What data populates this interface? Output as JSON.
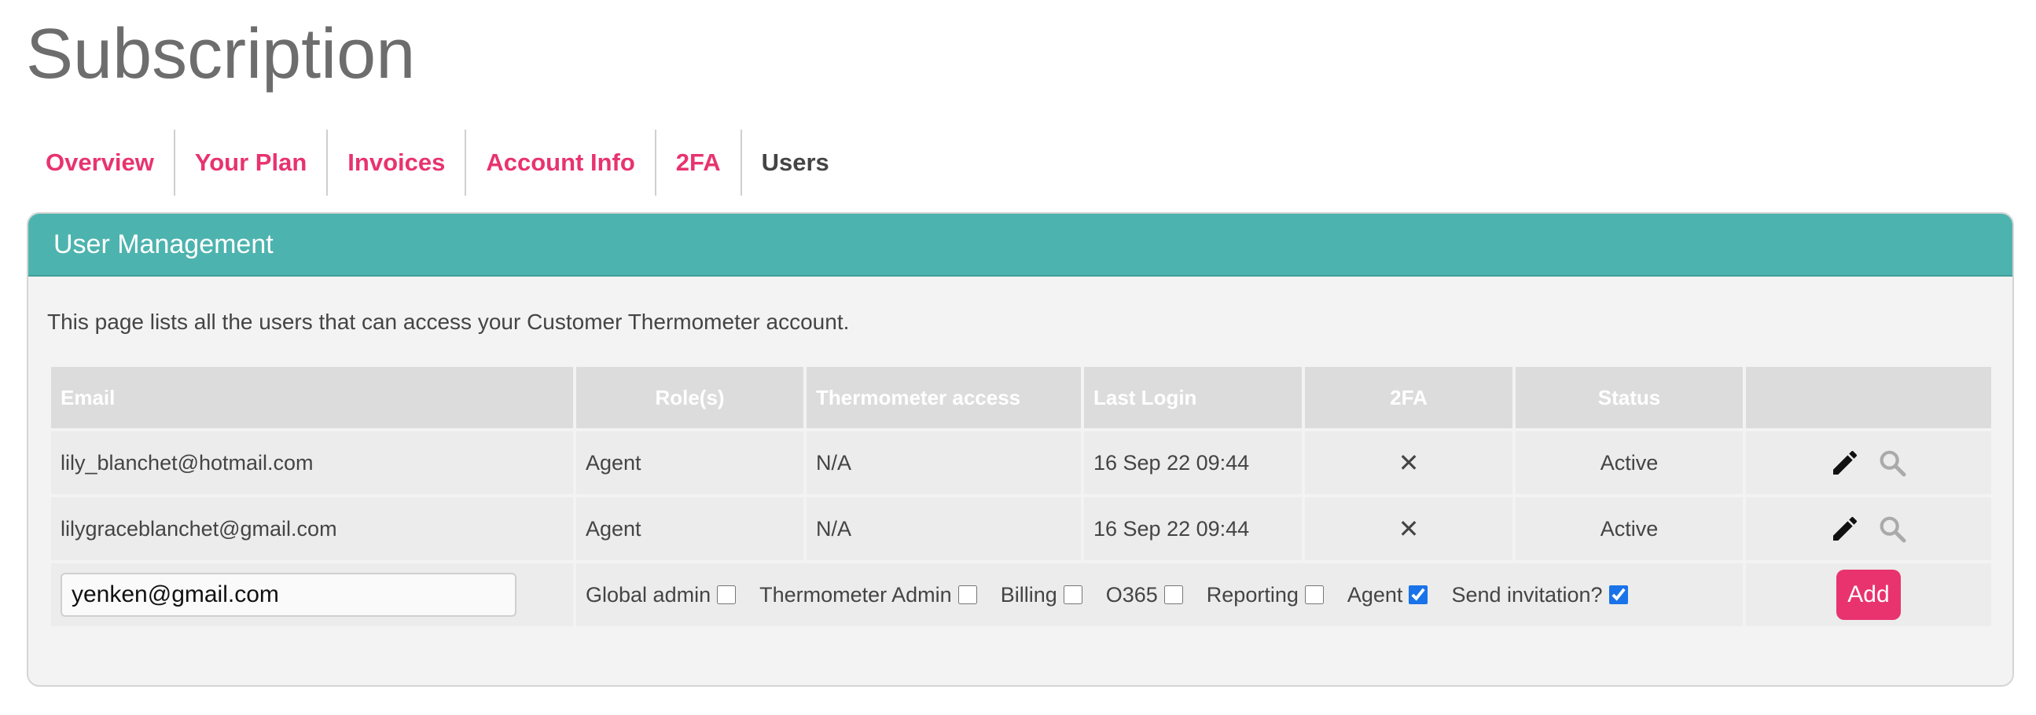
{
  "page": {
    "title": "Subscription"
  },
  "tabs": [
    {
      "label": "Overview",
      "active": false
    },
    {
      "label": "Your Plan",
      "active": false
    },
    {
      "label": "Invoices",
      "active": false
    },
    {
      "label": "Account Info",
      "active": false
    },
    {
      "label": "2FA",
      "active": false
    },
    {
      "label": "Users",
      "active": true
    }
  ],
  "panel": {
    "title": "User Management",
    "intro": "This page lists all the users that can access your Customer Thermometer account."
  },
  "table": {
    "headers": [
      "Email",
      "Role(s)",
      "Thermometer access",
      "Last Login",
      "2FA",
      "Status",
      ""
    ],
    "rows": [
      {
        "email": "lily_blanchet@hotmail.com",
        "roles": "Agent",
        "access": "N/A",
        "last_login": "16 Sep 22 09:44",
        "twofa": "✕",
        "status": "Active"
      },
      {
        "email": "lilygraceblanchet@gmail.com",
        "roles": "Agent",
        "access": "N/A",
        "last_login": "16 Sep 22 09:44",
        "twofa": "✕",
        "status": "Active"
      }
    ]
  },
  "new_user": {
    "email_value": "yenken@gmail.com",
    "roles": [
      {
        "label": "Global admin",
        "checked": false
      },
      {
        "label": "Thermometer Admin",
        "checked": false
      },
      {
        "label": "Billing",
        "checked": false
      },
      {
        "label": "O365",
        "checked": false
      },
      {
        "label": "Reporting",
        "checked": false
      },
      {
        "label": "Agent",
        "checked": true
      },
      {
        "label": "Send invitation?",
        "checked": true
      }
    ],
    "add_label": "Add"
  },
  "colors": {
    "accent": "#e8336f",
    "header": "#4db3ae"
  },
  "icons": {
    "edit": "pencil-icon",
    "view": "magnifier-icon"
  }
}
